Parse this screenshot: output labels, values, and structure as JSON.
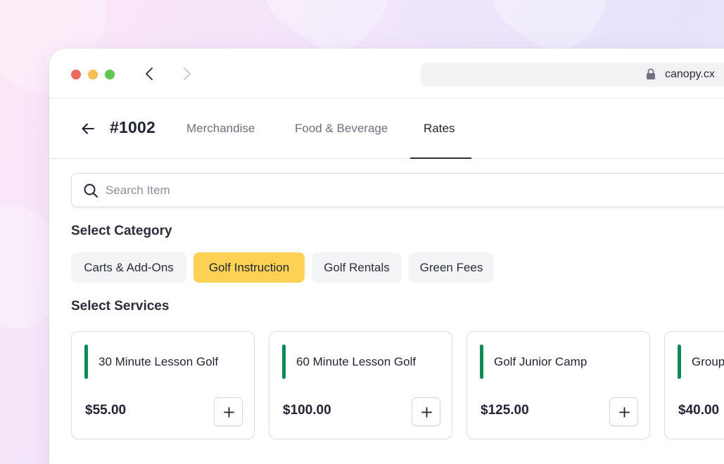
{
  "browser": {
    "url": "canopy.cx"
  },
  "header": {
    "order_id": "#1002",
    "tabs": [
      {
        "label": "Merchandise"
      },
      {
        "label": "Food & Beverage"
      },
      {
        "label": "Rates",
        "active": true
      }
    ]
  },
  "search": {
    "placeholder": "Search Item",
    "value": ""
  },
  "categories": {
    "title": "Select Category",
    "items": [
      {
        "label": "Carts & Add-Ons"
      },
      {
        "label": "Golf Instruction",
        "active": true
      },
      {
        "label": "Golf Rentals"
      },
      {
        "label": "Green Fees"
      }
    ]
  },
  "services": {
    "title": "Select Services",
    "items": [
      {
        "name": "30 Minute Lesson Golf",
        "price": "$55.00"
      },
      {
        "name": "60 Minute Lesson Golf",
        "price": "$100.00"
      },
      {
        "name": "Golf Junior Camp",
        "price": "$125.00"
      },
      {
        "name": "Group",
        "price": "$40.00"
      }
    ]
  },
  "colors": {
    "accent_active_chip": "#fdd254",
    "service_bar": "#0f8a56",
    "dot_red": "#ee6a5f",
    "dot_yellow": "#f5be4f",
    "dot_green": "#62c554"
  },
  "icons": [
    "chevron-left-icon",
    "chevron-right-icon",
    "lock-icon",
    "arrow-left-icon",
    "search-icon",
    "plus-icon"
  ]
}
